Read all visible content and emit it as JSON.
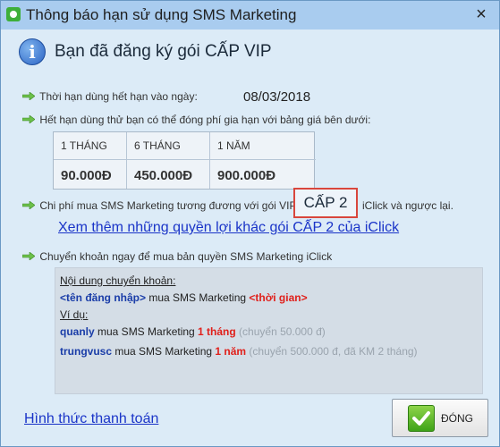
{
  "window": {
    "title": "Thông báo hạn sử dụng SMS Marketing",
    "close_glyph": "×"
  },
  "headline": "Bạn đã đăng ký gói CẤP VIP",
  "expiry": {
    "label": "Thời hạn dùng hết hạn vào ngày:",
    "date": "08/03/2018"
  },
  "renewal_note": "Hết hạn dùng thử bạn có thể  đóng phí gia hạn với bảng giá bên dưới:",
  "price_table": {
    "columns": [
      {
        "period": "1 THÁNG",
        "price": "90.000Đ"
      },
      {
        "period": "6 THÁNG",
        "price": "450.000Đ"
      },
      {
        "period": "1 NĂM",
        "price": "900.000Đ"
      }
    ]
  },
  "equivalent": {
    "label": "Chi phí mua SMS Marketing tương đương với gói VIP:",
    "level": "CẤP 2",
    "suffix": "iClick và ngược lại."
  },
  "more_link": "Xem thêm những quyền lợi khác gói CẤP 2 của iClick",
  "transfer_note": "Chuyển khoản ngay để mua bản quyền SMS Marketing iClick",
  "transfer_box": {
    "heading": "Nội dung chuyển khoản:",
    "pattern_user": "<tên đăng nhập>",
    "pattern_mid": " mua SMS Marketing ",
    "pattern_time": "<thời gian>",
    "example_heading": "Ví dụ:",
    "examples": [
      {
        "user": "quanly",
        "mid": " mua SMS Marketing ",
        "time": "1 tháng",
        "note": "  (chuyển 50.000 đ)"
      },
      {
        "user": "trungvusc",
        "mid": " mua SMS Marketing ",
        "time": "1 năm",
        "note": "  (chuyển 500.000 đ, đã KM 2 tháng)"
      }
    ]
  },
  "payment_link": "Hình thức thanh toán",
  "close_button": "ĐÓNG",
  "colors": {
    "accent_red": "#e0201b",
    "link_blue": "#1a34c8",
    "bullet_green": "#6cc04a"
  }
}
